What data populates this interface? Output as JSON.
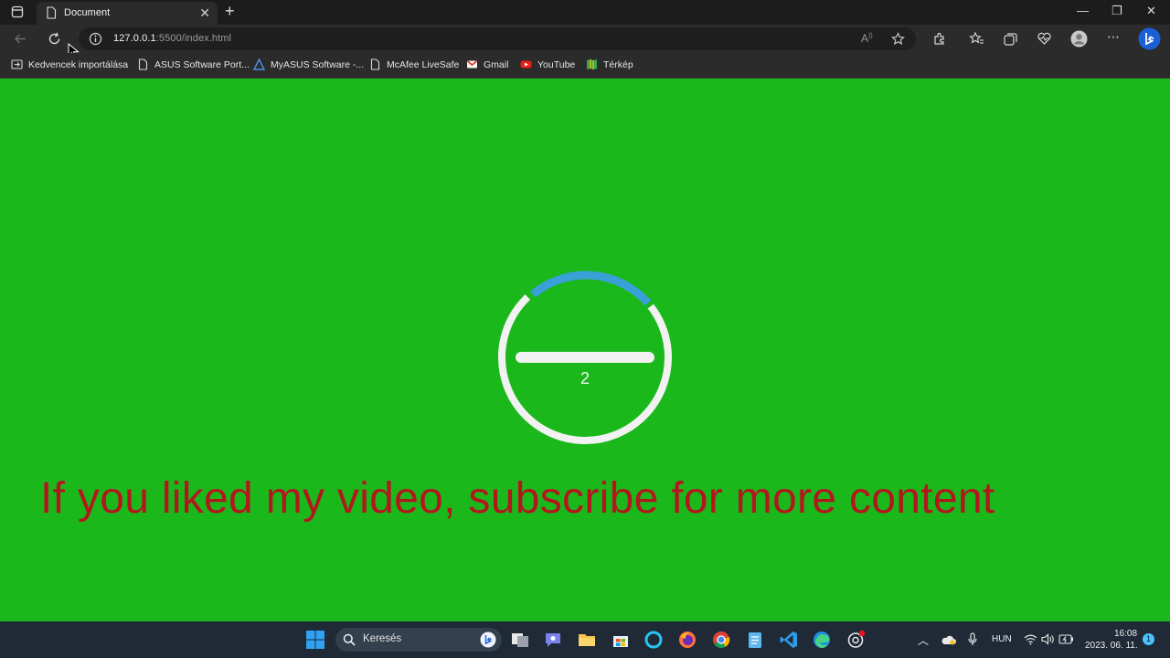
{
  "browser": {
    "tab_title": "Document",
    "url_host": "127.0.0.1",
    "url_rest": ":5500/index.html",
    "bookmarks": [
      {
        "label": "Kedvencek importálása",
        "icon": "import-favorites-icon"
      },
      {
        "label": "ASUS Software Port...",
        "icon": "page-icon"
      },
      {
        "label": "MyASUS Software -...",
        "icon": "myasus-icon"
      },
      {
        "label": "McAfee LiveSafe",
        "icon": "page-icon"
      },
      {
        "label": "Gmail",
        "icon": "gmail-icon"
      },
      {
        "label": "YouTube",
        "icon": "youtube-icon"
      },
      {
        "label": "Térkép",
        "icon": "maps-icon"
      }
    ]
  },
  "page": {
    "counter": "2",
    "headline": "If you liked my video, subscribe for more content",
    "colors": {
      "background": "#1bb81b",
      "ring": "#f2f2f2",
      "arc": "#3aa0d8",
      "headline": "#b3171e"
    }
  },
  "taskbar": {
    "search_label": "Keresés",
    "language": "HUN",
    "time": "16:08",
    "date": "2023. 06. 11.",
    "notification_count": "1"
  }
}
